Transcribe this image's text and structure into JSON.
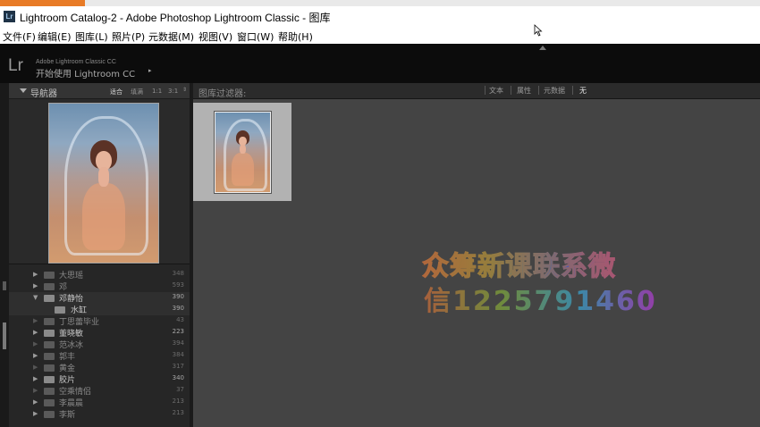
{
  "window": {
    "title": "Lightroom Catalog-2 - Adobe Photoshop Lightroom Classic - 图库",
    "app_icon": "Lr"
  },
  "menu": [
    {
      "label": "文件(F)"
    },
    {
      "label": "编辑(E)"
    },
    {
      "label": "图库(L)"
    },
    {
      "label": "照片(P)"
    },
    {
      "label": "元数据(M)"
    },
    {
      "label": "视图(V)"
    },
    {
      "label": "窗口(W)"
    },
    {
      "label": "帮助(H)"
    }
  ],
  "header": {
    "logo": "Lr",
    "brand_sub": "Adobe Lightroom Classic CC",
    "identity": "开始使用 Lightroom CC",
    "identity_arrow": "▸"
  },
  "navigator": {
    "title": "导航器",
    "zoom_options": [
      {
        "label": "适合"
      },
      {
        "label": "填满"
      },
      {
        "label": "1:1"
      },
      {
        "label": "3:1"
      }
    ],
    "zoom_stepper": "⇕"
  },
  "folders": [
    {
      "label": "大思瑶",
      "count": "348",
      "expanded": false
    },
    {
      "label": "邓",
      "count": "593",
      "expanded": false
    },
    {
      "label": "邓静怡",
      "count": "390",
      "expanded": true
    },
    {
      "label": "水缸",
      "count": "390",
      "child": true
    },
    {
      "label": "丁思蕾毕业",
      "count": "43",
      "expanded": false
    },
    {
      "label": "董晓敏",
      "count": "223",
      "expanded": false
    },
    {
      "label": "范冰冰",
      "count": "394",
      "expanded": false
    },
    {
      "label": "郭丰",
      "count": "384",
      "expanded": false
    },
    {
      "label": "黄金",
      "count": "317",
      "expanded": false
    },
    {
      "label": "胶片",
      "count": "340",
      "expanded": false
    },
    {
      "label": "空乘情侣",
      "count": "37",
      "expanded": false
    },
    {
      "label": "李晨晨",
      "count": "213",
      "expanded": false
    },
    {
      "label": "李斯",
      "count": "213",
      "expanded": false
    }
  ],
  "filter_bar": {
    "label": "图库过滤器:",
    "tabs": [
      {
        "label": "文本"
      },
      {
        "label": "属性"
      },
      {
        "label": "元数据"
      },
      {
        "label": "无"
      }
    ],
    "active": "无"
  },
  "watermark": {
    "line1": "众筹新课联系微",
    "line2": "信1225791460"
  }
}
